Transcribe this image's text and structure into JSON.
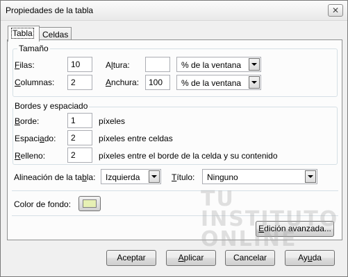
{
  "window": {
    "title": "Propiedades de la tabla",
    "close_glyph": "✕"
  },
  "tabs": [
    {
      "label": "Tabla",
      "active": true
    },
    {
      "label": "Celdas",
      "active": false
    }
  ],
  "size_group": {
    "legend": "Tamaño",
    "rows_label_u": "F",
    "rows_label_rest": "ilas:",
    "rows_value": "10",
    "height_label_pre": "A",
    "height_label_u": "l",
    "height_label_rest": "tura:",
    "height_value": "",
    "height_unit": "% de la ventana",
    "cols_label_u": "C",
    "cols_label_rest": "olumnas:",
    "cols_value": "2",
    "width_label_u": "A",
    "width_label_rest": "nchura:",
    "width_value": "100",
    "width_unit": "% de la ventana"
  },
  "borders_group": {
    "legend": "Bordes y espaciado",
    "border_label_u": "B",
    "border_label_rest": "orde:",
    "border_value": "1",
    "border_unit": "píxeles",
    "spacing_label_pre": "Espaci",
    "spacing_label_u": "a",
    "spacing_label_rest": "do:",
    "spacing_value": "2",
    "spacing_unit": "píxeles entre celdas",
    "padding_label_u": "R",
    "padding_label_rest": "elleno:",
    "padding_value": "2",
    "padding_unit": "píxeles entre el borde de la celda y su contenido"
  },
  "alignment": {
    "label_pre": "Alineación de la ta",
    "label_u": "b",
    "label_rest": "la:",
    "value": "Izquierda"
  },
  "caption": {
    "label_u": "T",
    "label_rest": "ítulo:",
    "value": "Ninguno"
  },
  "background": {
    "label": "Color de fondo:",
    "swatch_color": "#e6f0b4"
  },
  "advanced_button": {
    "pre": "",
    "u": "E",
    "rest": "dición avanzada..."
  },
  "watermark": {
    "line1": "TU",
    "line2": "INSTITUTO",
    "line3": "ONLINE"
  },
  "buttons": {
    "accept": "Aceptar",
    "apply_u": "A",
    "apply_rest": "plicar",
    "cancel": "Cancelar",
    "help_pre": "Ay",
    "help_u": "u",
    "help_rest": "da"
  }
}
